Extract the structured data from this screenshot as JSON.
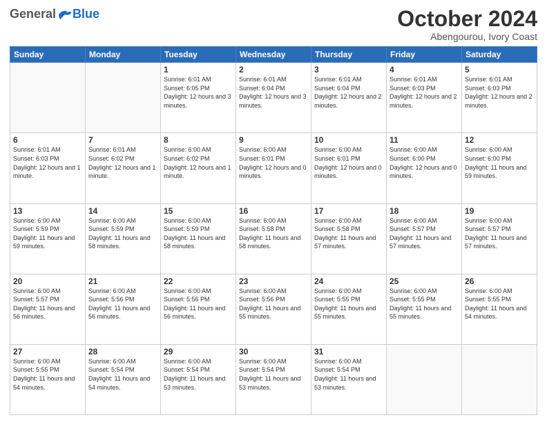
{
  "header": {
    "logo": {
      "general": "General",
      "blue": "Blue"
    },
    "title": "October 2024",
    "subtitle": "Abengourou, Ivory Coast"
  },
  "weekdays": [
    "Sunday",
    "Monday",
    "Tuesday",
    "Wednesday",
    "Thursday",
    "Friday",
    "Saturday"
  ],
  "weeks": [
    [
      {
        "day": "",
        "empty": true
      },
      {
        "day": "",
        "empty": true
      },
      {
        "day": "1",
        "sunrise": "6:01 AM",
        "sunset": "6:05 PM",
        "daylight": "12 hours and 3 minutes."
      },
      {
        "day": "2",
        "sunrise": "6:01 AM",
        "sunset": "6:04 PM",
        "daylight": "12 hours and 3 minutes."
      },
      {
        "day": "3",
        "sunrise": "6:01 AM",
        "sunset": "6:04 PM",
        "daylight": "12 hours and 2 minutes."
      },
      {
        "day": "4",
        "sunrise": "6:01 AM",
        "sunset": "6:03 PM",
        "daylight": "12 hours and 2 minutes."
      },
      {
        "day": "5",
        "sunrise": "6:01 AM",
        "sunset": "6:03 PM",
        "daylight": "12 hours and 2 minutes."
      }
    ],
    [
      {
        "day": "6",
        "sunrise": "6:01 AM",
        "sunset": "6:03 PM",
        "daylight": "12 hours and 1 minute."
      },
      {
        "day": "7",
        "sunrise": "6:01 AM",
        "sunset": "6:02 PM",
        "daylight": "12 hours and 1 minute."
      },
      {
        "day": "8",
        "sunrise": "6:00 AM",
        "sunset": "6:02 PM",
        "daylight": "12 hours and 1 minute."
      },
      {
        "day": "9",
        "sunrise": "6:00 AM",
        "sunset": "6:01 PM",
        "daylight": "12 hours and 0 minutes."
      },
      {
        "day": "10",
        "sunrise": "6:00 AM",
        "sunset": "6:01 PM",
        "daylight": "12 hours and 0 minutes."
      },
      {
        "day": "11",
        "sunrise": "6:00 AM",
        "sunset": "6:00 PM",
        "daylight": "12 hours and 0 minutes."
      },
      {
        "day": "12",
        "sunrise": "6:00 AM",
        "sunset": "6:00 PM",
        "daylight": "11 hours and 59 minutes."
      }
    ],
    [
      {
        "day": "13",
        "sunrise": "6:00 AM",
        "sunset": "5:59 PM",
        "daylight": "11 hours and 59 minutes."
      },
      {
        "day": "14",
        "sunrise": "6:00 AM",
        "sunset": "5:59 PM",
        "daylight": "11 hours and 58 minutes."
      },
      {
        "day": "15",
        "sunrise": "6:00 AM",
        "sunset": "5:59 PM",
        "daylight": "11 hours and 58 minutes."
      },
      {
        "day": "16",
        "sunrise": "6:00 AM",
        "sunset": "5:58 PM",
        "daylight": "11 hours and 58 minutes."
      },
      {
        "day": "17",
        "sunrise": "6:00 AM",
        "sunset": "5:58 PM",
        "daylight": "11 hours and 57 minutes."
      },
      {
        "day": "18",
        "sunrise": "6:00 AM",
        "sunset": "5:57 PM",
        "daylight": "11 hours and 57 minutes."
      },
      {
        "day": "19",
        "sunrise": "6:00 AM",
        "sunset": "5:57 PM",
        "daylight": "11 hours and 57 minutes."
      }
    ],
    [
      {
        "day": "20",
        "sunrise": "6:00 AM",
        "sunset": "5:57 PM",
        "daylight": "11 hours and 56 minutes."
      },
      {
        "day": "21",
        "sunrise": "6:00 AM",
        "sunset": "5:56 PM",
        "daylight": "11 hours and 56 minutes."
      },
      {
        "day": "22",
        "sunrise": "6:00 AM",
        "sunset": "5:56 PM",
        "daylight": "11 hours and 56 minutes."
      },
      {
        "day": "23",
        "sunrise": "6:00 AM",
        "sunset": "5:56 PM",
        "daylight": "11 hours and 55 minutes."
      },
      {
        "day": "24",
        "sunrise": "6:00 AM",
        "sunset": "5:55 PM",
        "daylight": "11 hours and 55 minutes."
      },
      {
        "day": "25",
        "sunrise": "6:00 AM",
        "sunset": "5:55 PM",
        "daylight": "11 hours and 55 minutes."
      },
      {
        "day": "26",
        "sunrise": "6:00 AM",
        "sunset": "5:55 PM",
        "daylight": "11 hours and 54 minutes."
      }
    ],
    [
      {
        "day": "27",
        "sunrise": "6:00 AM",
        "sunset": "5:55 PM",
        "daylight": "11 hours and 54 minutes."
      },
      {
        "day": "28",
        "sunrise": "6:00 AM",
        "sunset": "5:54 PM",
        "daylight": "11 hours and 54 minutes."
      },
      {
        "day": "29",
        "sunrise": "6:00 AM",
        "sunset": "5:54 PM",
        "daylight": "11 hours and 53 minutes."
      },
      {
        "day": "30",
        "sunrise": "6:00 AM",
        "sunset": "5:54 PM",
        "daylight": "11 hours and 53 minutes."
      },
      {
        "day": "31",
        "sunrise": "6:00 AM",
        "sunset": "5:54 PM",
        "daylight": "11 hours and 53 minutes."
      },
      {
        "day": "",
        "empty": true
      },
      {
        "day": "",
        "empty": true
      }
    ]
  ]
}
